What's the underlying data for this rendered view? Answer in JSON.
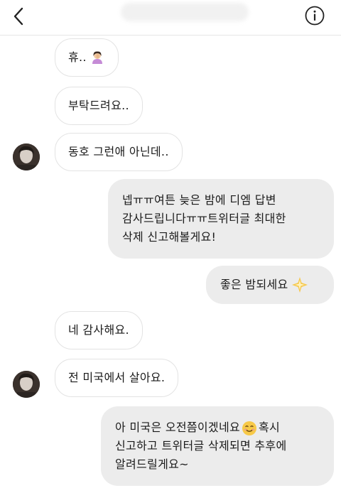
{
  "header": {
    "back_icon": "chevron-left-icon",
    "info_icon": "info-circle-icon"
  },
  "messages": [
    {
      "side": "in",
      "avatar": false,
      "lines": [
        "휴.. "
      ],
      "emoji": "woman-facepalming-emoji"
    },
    {
      "side": "in",
      "avatar": false,
      "lines": [
        "부탁드려요.."
      ]
    },
    {
      "side": "in",
      "avatar": true,
      "lines": [
        "동호 그런애 아닌데.."
      ]
    },
    {
      "side": "out",
      "lines": [
        "넵ㅠㅠ여튼 늦은 밤에 디엠 답변",
        "감사드립니다ㅠㅠ트위터글 최대한",
        "삭제 신고해볼게요!"
      ]
    },
    {
      "side": "out",
      "lines": [
        "좋은 밤되세요"
      ],
      "emoji": "sparkle-star-emoji"
    },
    {
      "side": "in",
      "avatar": false,
      "lines": [
        "네 감사해요."
      ]
    },
    {
      "side": "in",
      "avatar": true,
      "lines": [
        "전 미국에서 살아요."
      ]
    },
    {
      "side": "out",
      "lines": [
        "아 미국은 오전쯤이겠네요",
        "신고하고 트위터글 삭제되면 추후에",
        "알려드릴게요~"
      ],
      "inline": {
        "emoji": "smiling-face-emoji",
        "after": "혹시"
      }
    }
  ],
  "colors": {
    "incoming_bg": "#ffffff",
    "incoming_border": "#e3e3e3",
    "outgoing_bg": "#ececec",
    "text": "#1b1b1b"
  }
}
